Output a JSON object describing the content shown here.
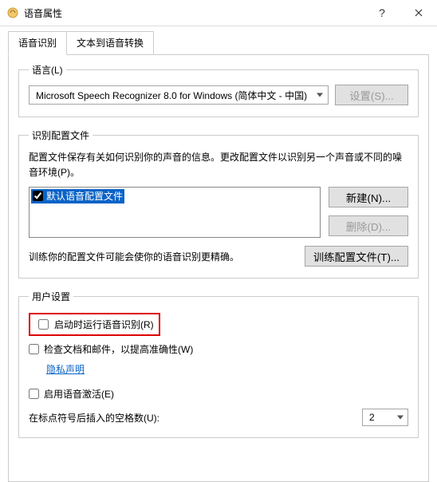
{
  "window": {
    "title": "语音属性"
  },
  "tabs": {
    "recognition": "语音识别",
    "tts": "文本到语音转换"
  },
  "language": {
    "legend": "语言(L)",
    "selected": "Microsoft Speech Recognizer 8.0 for Windows (简体中文 - 中国)",
    "settings_btn": "设置(S)..."
  },
  "profiles": {
    "legend": "识别配置文件",
    "desc": "配置文件保存有关如何识别你的声音的信息。更改配置文件以识别另一个声音或不同的噪音环境(P)。",
    "default_item": "默认语音配置文件",
    "new_btn": "新建(N)...",
    "delete_btn": "删除(D)...",
    "train_desc": "训练你的配置文件可能会使你的语音识别更精确。",
    "train_btn": "训练配置文件(T)..."
  },
  "user": {
    "legend": "用户设置",
    "run_at_startup": "启动时运行语音识别(R)",
    "review_docs": "检查文档和邮件，以提高准确性(W)",
    "privacy_link": "隐私声明",
    "voice_activation": "启用语音激活(E)",
    "spaces_label": "在标点符号后插入的空格数(U):",
    "spaces_value": "2"
  }
}
